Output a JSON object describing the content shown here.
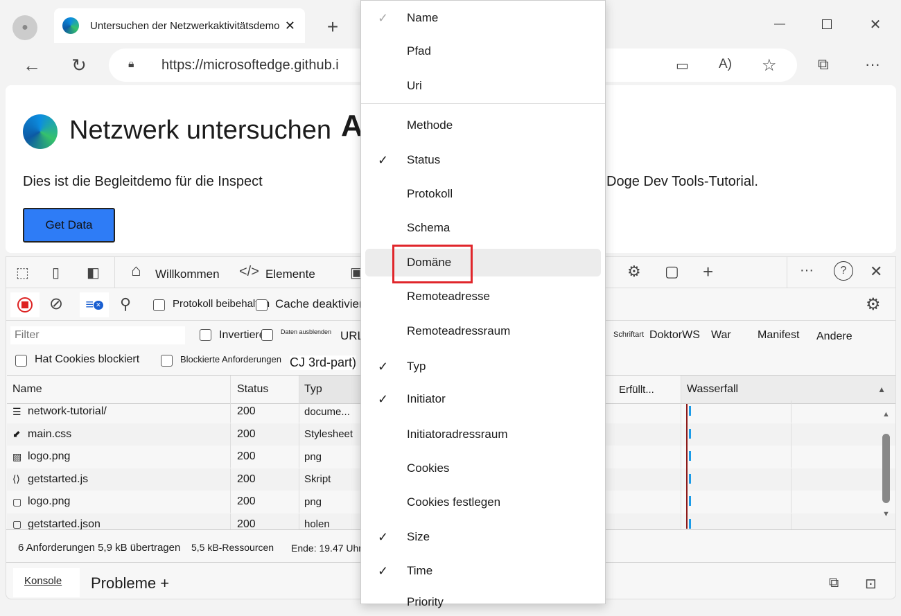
{
  "browser": {
    "tab_title": "Untersuchen der Netzwerkaktivitätsdemo",
    "url": "https://microsoftedge.github.i"
  },
  "page": {
    "title": "Netzwerk untersuchen",
    "title_overlap": "A",
    "desc_left": "Dies ist die Begleitdemo für die Inspect",
    "desc_right": "Doge Dev Tools-Tutorial.",
    "button": "Get Data"
  },
  "devtools": {
    "tabs": {
      "welcome": "Willkommen",
      "elements": "Elemente"
    },
    "toolbar": {
      "preserve_log": "Protokoll beibehalten",
      "disable_cache": "Cache deaktivieren"
    },
    "filter": {
      "placeholder": "Filter",
      "invert": "Invertieren",
      "hide_data": "Daten ausblenden",
      "url": "URL",
      "types": [
        "Schriftart",
        "DoktorWS",
        "War",
        "Manifest",
        "Andere"
      ],
      "blocked_cookies": "Hat Cookies blockiert",
      "blocked_requests": "Blockierte Anforderungen",
      "third_party": "CJ 3rd-part)"
    },
    "columns": {
      "name": "Name",
      "status": "Status",
      "type": "Typ",
      "fulfilled": "Erfüllt...",
      "waterfall": "Wasserfall"
    },
    "rows": [
      {
        "name": "network-tutorial/",
        "status": "200",
        "type": "docume...",
        "icon": "document-icon"
      },
      {
        "name": "main.css",
        "status": "200",
        "type": "Stylesheet",
        "icon": "css-icon"
      },
      {
        "name": "logo.png",
        "status": "200",
        "type": "png",
        "icon": "image-icon"
      },
      {
        "name": "getstarted.js",
        "status": "200",
        "type": "Skript",
        "icon": "script-icon"
      },
      {
        "name": "logo.png",
        "status": "200",
        "type": "png",
        "icon": "file-icon"
      },
      {
        "name": "getstarted.json",
        "status": "200",
        "type": "holen",
        "icon": "file-icon"
      }
    ],
    "status_bar": {
      "requests": "6 Anforderungen 5,9 kB übertragen",
      "resources": "5,5 kB-Ressourcen",
      "finish": "Ende: 19.47 Uhr"
    },
    "drawer": {
      "console": "Konsole",
      "issues": "Probleme +"
    }
  },
  "menu": {
    "items": [
      {
        "label": "Name",
        "checked": true
      },
      {
        "label": "Pfad",
        "checked": false
      },
      {
        "label": "Uri",
        "checked": false
      },
      {
        "label": "Methode",
        "checked": false
      },
      {
        "label": "Status",
        "checked": true
      },
      {
        "label": "Protokoll",
        "checked": false
      },
      {
        "label": "Schema",
        "checked": false
      },
      {
        "label": "Domäne",
        "checked": false
      },
      {
        "label": "Remoteadresse",
        "checked": false
      },
      {
        "label": "Remoteadressraum",
        "checked": false
      },
      {
        "label": "Typ",
        "checked": true
      },
      {
        "label": "Initiator",
        "checked": true
      },
      {
        "label": "Initiatoradressraum",
        "checked": false
      },
      {
        "label": "Cookies",
        "checked": false
      },
      {
        "label": "Cookies festlegen",
        "checked": false
      },
      {
        "label": "Size",
        "checked": true
      },
      {
        "label": "Time",
        "checked": true
      },
      {
        "label": "Priority",
        "checked": false
      }
    ]
  }
}
